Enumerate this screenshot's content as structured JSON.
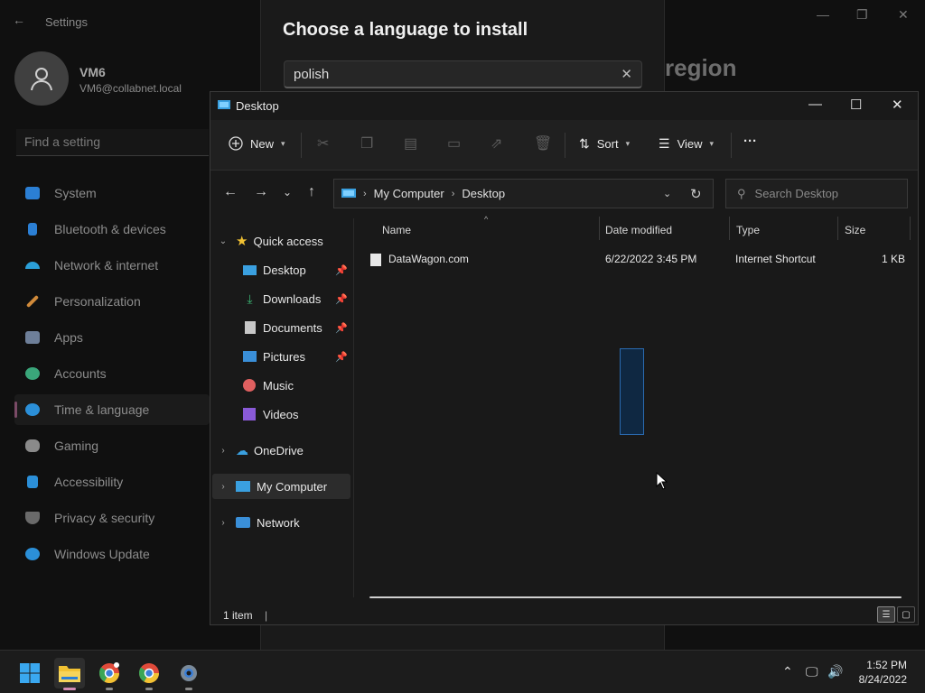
{
  "settings": {
    "title": "Settings",
    "user_name": "VM6",
    "user_email": "VM6@collabnet.local",
    "search_placeholder": "Find a setting",
    "nav": [
      {
        "label": "System",
        "icon": "monitor-icon",
        "color": "#2b7fd4"
      },
      {
        "label": "Bluetooth & devices",
        "icon": "bluetooth-icon",
        "color": "#2b7fd4"
      },
      {
        "label": "Network & internet",
        "icon": "wifi-icon",
        "color": "#2b9fd8"
      },
      {
        "label": "Personalization",
        "icon": "brush-icon",
        "color": "#d08a3a"
      },
      {
        "label": "Apps",
        "icon": "apps-icon",
        "color": "#6e7f99"
      },
      {
        "label": "Accounts",
        "icon": "person-icon",
        "color": "#3aa67a"
      },
      {
        "label": "Time & language",
        "icon": "globe-clock-icon",
        "color": "#2b8fd8"
      },
      {
        "label": "Gaming",
        "icon": "gamepad-icon",
        "color": "#8a8a8a"
      },
      {
        "label": "Accessibility",
        "icon": "accessibility-icon",
        "color": "#2b8fd8"
      },
      {
        "label": "Privacy & security",
        "icon": "shield-icon",
        "color": "#6a6a6a"
      },
      {
        "label": "Windows Update",
        "icon": "update-icon",
        "color": "#2b8fd8"
      }
    ],
    "active_nav": "Time & language",
    "page_title_partial": "region"
  },
  "language_dialog": {
    "title": "Choose a language to install",
    "search_value": "polish"
  },
  "explorer": {
    "window_title": "Desktop",
    "toolbar": {
      "new_label": "New",
      "sort_label": "Sort",
      "view_label": "View",
      "more_label": "···"
    },
    "address": [
      "My Computer",
      "Desktop"
    ],
    "search_placeholder": "Search Desktop",
    "tree": {
      "quick_access": "Quick access",
      "items": [
        {
          "label": "Desktop",
          "icon": "desktop-folder-icon",
          "pinned": true
        },
        {
          "label": "Downloads",
          "icon": "downloads-icon",
          "pinned": true
        },
        {
          "label": "Documents",
          "icon": "documents-icon",
          "pinned": true
        },
        {
          "label": "Pictures",
          "icon": "pictures-icon",
          "pinned": true
        },
        {
          "label": "Music",
          "icon": "music-icon",
          "pinned": false
        },
        {
          "label": "Videos",
          "icon": "videos-icon",
          "pinned": false
        }
      ],
      "onedrive": "OneDrive",
      "my_computer": "My Computer",
      "network": "Network"
    },
    "columns": {
      "name": "Name",
      "date": "Date modified",
      "type": "Type",
      "size": "Size"
    },
    "files": [
      {
        "name": "DataWagon.com",
        "date": "6/22/2022 3:45 PM",
        "type": "Internet Shortcut",
        "size": "1 KB"
      }
    ],
    "status": "1 item"
  },
  "taskbar": {
    "time": "1:52 PM",
    "date": "8/24/2022"
  }
}
